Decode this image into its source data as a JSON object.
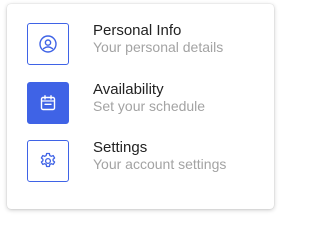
{
  "colors": {
    "accent": "#3f63e6",
    "title_text": "#222222",
    "subtitle_text": "#a3a3a3"
  },
  "menu": {
    "items": [
      {
        "icon": "user-circle-icon",
        "title": "Personal Info",
        "subtitle": "Your personal details",
        "selected": false
      },
      {
        "icon": "calendar-icon",
        "title": "Availability",
        "subtitle": "Set your schedule",
        "selected": true
      },
      {
        "icon": "gear-icon",
        "title": "Settings",
        "subtitle": "Your account settings",
        "selected": false
      }
    ]
  }
}
